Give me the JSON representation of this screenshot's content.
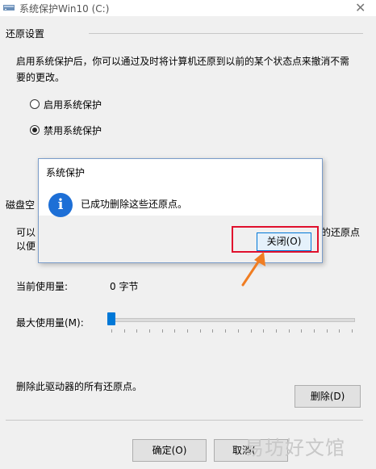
{
  "window": {
    "title": "系统保护Win10 (C:)",
    "close_glyph": "✕"
  },
  "restore_settings": {
    "section_title": "还原设置",
    "description_line1": "启用系统保护后，你可以通过及时将计算机还原到以前的某个状态点来撤消不需",
    "description_line2": "要的更改。",
    "radio_enable_label": "启用系统保护",
    "radio_disable_label": "禁用系统保护",
    "selected": "禁用系统保护"
  },
  "disk_space": {
    "section_title_partial": "磁盘空",
    "desc_left_line1": "可以",
    "desc_left_line2": "以便",
    "desc_right": "的还原点",
    "current_usage_label": "当前使用量:",
    "current_usage_value": "0 字节",
    "max_usage_label": "最大使用量(M):",
    "max_usage_level_fraction": 0
  },
  "delete_section": {
    "text": "删除此驱动器的所有还原点。",
    "delete_button": "删除(D)"
  },
  "footer": {
    "ok_button": "确定(O)",
    "cancel_button_partial": "取消("
  },
  "message_box": {
    "title": "系统保护",
    "icon": "info-icon",
    "icon_glyph": "i",
    "message": "已成功删除这些还原点。",
    "close_button": "关闭(O)"
  },
  "annotation": {
    "highlight_color": "#e0102d",
    "arrow_color": "#f07d22"
  },
  "watermark": "易坊好文馆"
}
